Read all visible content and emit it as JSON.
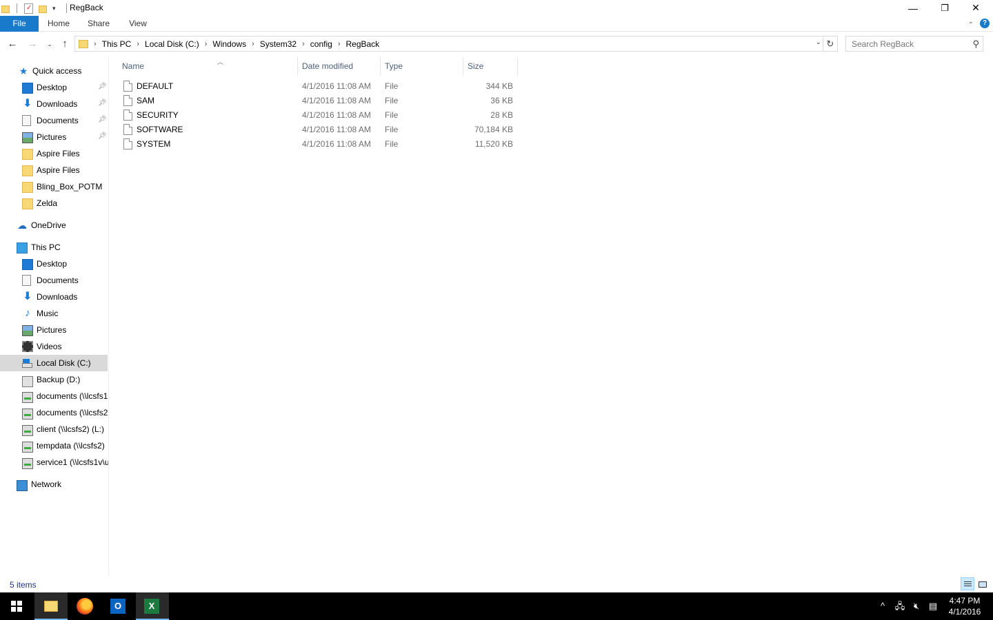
{
  "window": {
    "title": "RegBack",
    "controls": {
      "minimize": "—",
      "restore": "❐",
      "close": "✕"
    }
  },
  "ribbon": {
    "tabs": [
      "File",
      "Home",
      "Share",
      "View"
    ],
    "help": "?"
  },
  "address": {
    "crumbs": [
      "This PC",
      "Local Disk (C:)",
      "Windows",
      "System32",
      "config",
      "RegBack"
    ]
  },
  "search": {
    "placeholder": "Search RegBack"
  },
  "navpane": {
    "quick_access": {
      "label": "Quick access",
      "items": [
        {
          "label": "Desktop",
          "icon": "desktop-icon",
          "pinned": true
        },
        {
          "label": "Downloads",
          "icon": "downloads-icon",
          "pinned": true
        },
        {
          "label": "Documents",
          "icon": "documents-icon",
          "pinned": true
        },
        {
          "label": "Pictures",
          "icon": "pictures-icon",
          "pinned": true
        },
        {
          "label": "Aspire Files",
          "icon": "folder-icon",
          "pinned": false
        },
        {
          "label": "Aspire Files",
          "icon": "folder-icon",
          "pinned": false
        },
        {
          "label": "Bling_Box_POTM",
          "icon": "folder-icon",
          "pinned": false
        },
        {
          "label": "Zelda",
          "icon": "folder-icon",
          "pinned": false
        }
      ]
    },
    "onedrive": {
      "label": "OneDrive"
    },
    "this_pc": {
      "label": "This PC",
      "items": [
        {
          "label": "Desktop",
          "icon": "desktop-icon"
        },
        {
          "label": "Documents",
          "icon": "documents-icon"
        },
        {
          "label": "Downloads",
          "icon": "downloads-icon"
        },
        {
          "label": "Music",
          "icon": "music-icon"
        },
        {
          "label": "Pictures",
          "icon": "pictures-icon"
        },
        {
          "label": "Videos",
          "icon": "videos-icon"
        },
        {
          "label": "Local Disk (C:)",
          "icon": "local-disk-icon",
          "selected": true
        },
        {
          "label": "Backup (D:)",
          "icon": "drive-icon"
        },
        {
          "label": "documents (\\\\lcsfs1",
          "icon": "network-drive-icon"
        },
        {
          "label": "documents (\\\\lcsfs2",
          "icon": "network-drive-icon"
        },
        {
          "label": "client (\\\\lcsfs2) (L:)",
          "icon": "network-drive-icon"
        },
        {
          "label": "tempdata (\\\\lcsfs2)",
          "icon": "network-drive-icon"
        },
        {
          "label": "service1 (\\\\lcsfs1v\\u",
          "icon": "network-drive-icon"
        }
      ]
    },
    "network": {
      "label": "Network"
    }
  },
  "filelist": {
    "columns": [
      "Name",
      "Date modified",
      "Type",
      "Size"
    ],
    "rows": [
      {
        "name": "DEFAULT",
        "date": "4/1/2016 11:08 AM",
        "type": "File",
        "size": "344 KB"
      },
      {
        "name": "SAM",
        "date": "4/1/2016 11:08 AM",
        "type": "File",
        "size": "36 KB"
      },
      {
        "name": "SECURITY",
        "date": "4/1/2016 11:08 AM",
        "type": "File",
        "size": "28 KB"
      },
      {
        "name": "SOFTWARE",
        "date": "4/1/2016 11:08 AM",
        "type": "File",
        "size": "70,184 KB"
      },
      {
        "name": "SYSTEM",
        "date": "4/1/2016 11:08 AM",
        "type": "File",
        "size": "11,520 KB"
      }
    ]
  },
  "status": {
    "items_count": "5 items"
  },
  "taskbar": {
    "apps": [
      "File Explorer",
      "Firefox",
      "Outlook",
      "Excel"
    ],
    "outlook_glyph": "O",
    "excel_glyph": "X",
    "time": "4:47 PM",
    "date": "4/1/2016"
  },
  "colors": {
    "accent": "#1979ca",
    "selected": "#d9d9d9",
    "taskbar": "#000000"
  }
}
